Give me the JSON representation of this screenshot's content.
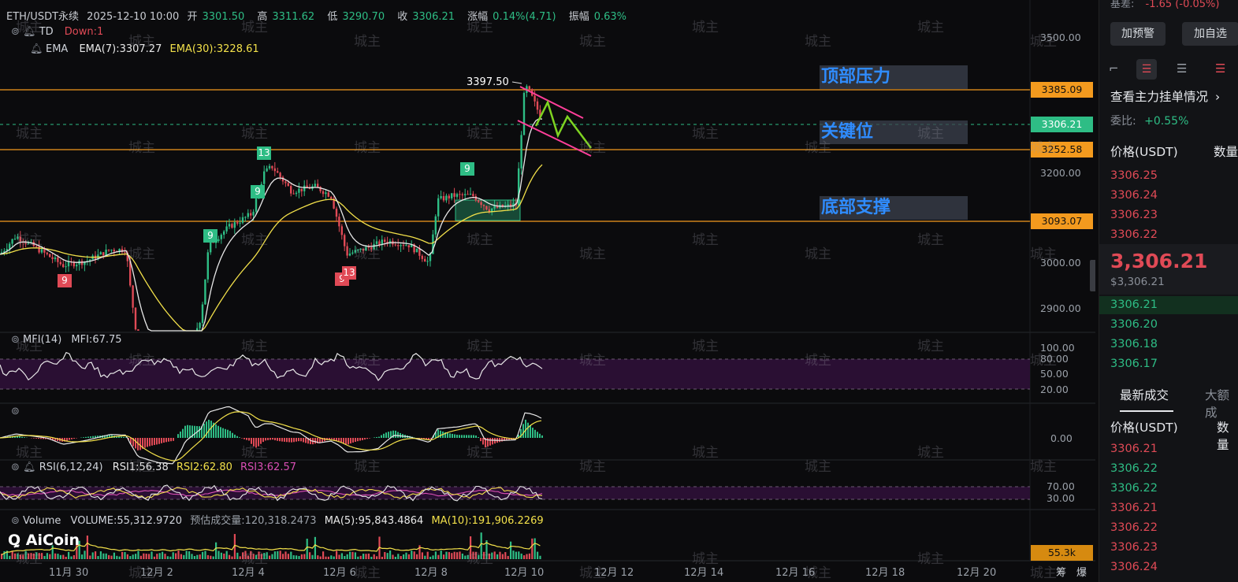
{
  "header": {
    "symbol": "ETH/USDT永续",
    "datetime": "2025-12-10 10:00",
    "open_label": "开",
    "open": "3301.50",
    "high_label": "高",
    "high": "3311.62",
    "low_label": "低",
    "low": "3290.70",
    "close_label": "收",
    "close": "3306.21",
    "change_label": "涨幅",
    "change": "0.14%(4.71)",
    "amp_label": "振幅",
    "amp": "0.63%"
  },
  "indicators": {
    "td": {
      "name": "TD",
      "value": "Down:1"
    },
    "ema": {
      "name": "EMA",
      "ema7": "EMA(7):3307.27",
      "ema30": "EMA(30):3228.61"
    },
    "mfi": {
      "name": "MFI(14)",
      "value": "MFI:67.75"
    },
    "rsi": {
      "name": "RSI(6,12,24)",
      "rsi1": "RSI1:56.38",
      "rsi2": "RSI2:62.80",
      "rsi3": "RSI3:62.57"
    },
    "volume": {
      "name": "Volume",
      "vol": "VOLUME:55,312.9720",
      "est": "预估成交量:120,318.2473",
      "ma5": "MA(5):95,843.4864",
      "ma10": "MA(10):191,906.2269"
    }
  },
  "annotations": {
    "peak": "3397.50",
    "zone_top": "顶部压力",
    "zone_key": "关键位",
    "zone_bottom": "底部支撑",
    "td_counts": [
      "13",
      "9",
      "9",
      "9",
      "9",
      "9",
      "13"
    ]
  },
  "price_tags": {
    "resistance": "3385.09",
    "current": "3306.21",
    "key": "3252.58",
    "support": "3093.07",
    "volume": "55.3k"
  },
  "y_axis": [
    "3500.00",
    "3200.00",
    "3000.00",
    "2900.00"
  ],
  "mfi_axis": [
    "100.00",
    "80.00",
    "50.00",
    "20.00"
  ],
  "macd_axis": [
    "0.00"
  ],
  "rsi_axis": [
    "70.00",
    "30.00"
  ],
  "x_axis": [
    "11月 30",
    "12月 2",
    "12月 4",
    "12月 6",
    "12月 8",
    "12月 10",
    "12月 12",
    "12月 14",
    "12月 16",
    "12月 18",
    "12月 20"
  ],
  "bottom_right": [
    "筹",
    "爆"
  ],
  "logo": "AiCoin",
  "watermark": "城主",
  "right_panel": {
    "basis_label": "基差:",
    "basis_value": "-1.65 (-0.05%)",
    "alert_button": "加预警",
    "watchlist_button": "加自选",
    "orderbook_link": "查看主力挂单情况",
    "ratio_label": "委比:",
    "ratio_value": "+0.55%",
    "price_header": "价格(USDT)",
    "qty_header": "数量",
    "asks": [
      "3306.25",
      "3306.24",
      "3306.23",
      "3306.22"
    ],
    "last_price": "3,306.21",
    "last_price_usd": "$3,306.21",
    "bids": [
      "3306.21",
      "3306.20",
      "3306.18",
      "3306.17"
    ],
    "tab_trades": "最新成交",
    "tab_large": "大额成",
    "trades_price_header": "价格(USDT)",
    "trades_qty_header": "数量",
    "trades": [
      {
        "price": "3306.21",
        "side": "sell"
      },
      {
        "price": "3306.22",
        "side": "buy"
      },
      {
        "price": "3306.22",
        "side": "buy"
      },
      {
        "price": "3306.21",
        "side": "sell"
      },
      {
        "price": "3306.22",
        "side": "sell"
      },
      {
        "price": "3306.23",
        "side": "sell"
      },
      {
        "price": "3306.24",
        "side": "sell"
      }
    ]
  },
  "colors": {
    "up": "#2ebd85",
    "down": "#e04a56",
    "level": "#f39a1e",
    "ema7": "#e8e8e8",
    "ema30": "#f2e04a",
    "zone_text": "#2f8cff",
    "channel": "#ff3f9a",
    "projection": "#7ed321"
  }
}
